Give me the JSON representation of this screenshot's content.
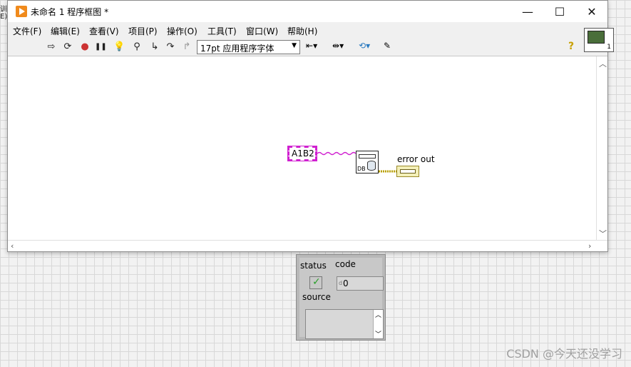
{
  "left_edge": {
    "glyph_top": "训",
    "glyph_mid": "E)"
  },
  "window": {
    "title": "未命名 1 程序框图 *",
    "controls": {
      "minimize": "—",
      "maximize": "☐",
      "close": "✕"
    }
  },
  "menu": {
    "file": "文件(F)",
    "edit": "编辑(E)",
    "view": "查看(V)",
    "project": "项目(P)",
    "operate": "操作(O)",
    "tools": "工具(T)",
    "window": "窗口(W)",
    "help": "帮助(H)"
  },
  "toolbar": {
    "run": "⇨",
    "run_continuous": "⟳",
    "abort": "●",
    "pause": "❚❚",
    "highlight": "💡",
    "retain_wire": "⚲",
    "step_into": "↳",
    "step_over": "↷",
    "step_out": "↱",
    "font": "17pt 应用程序字体",
    "align": "⇤",
    "distribute": "⇹",
    "reorder": "⟲",
    "cleanup": "✎",
    "help": "?"
  },
  "connector_pane": {
    "number": "1"
  },
  "diagram": {
    "constant": "A1B2",
    "vi_db_label": "DB",
    "error_out_label": "error out"
  },
  "error_cluster": {
    "status_label": "status",
    "code_label": "code",
    "code_value": "0",
    "code_prefix": "d",
    "source_label": "source"
  },
  "watermark": "CSDN @今天还没学习",
  "colors": {
    "string_wire": "#d020d0",
    "error_wire": "#b8a000",
    "accent": "#f08a1c"
  }
}
